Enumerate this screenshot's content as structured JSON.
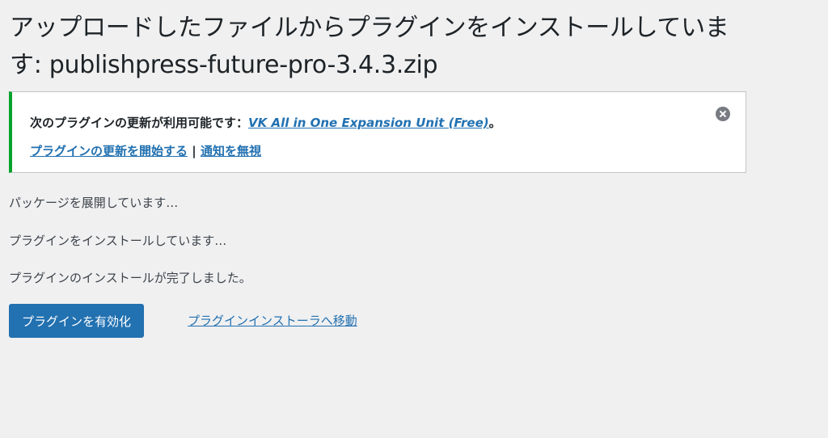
{
  "page": {
    "title": "アップロードしたファイルからプラグインをインストールしています: publishpress-future-pro-3.4.3.zip"
  },
  "notice": {
    "prefix": "次のプラグインの更新が利用可能です：",
    "plugin_name": "VK All in One Expansion Unit (Free)",
    "suffix": "。",
    "update_link": "プラグインの更新を開始する",
    "separator": " | ",
    "ignore_link": "通知を無視",
    "accent_color": "#00a32a",
    "dismiss_icon": "dismiss-icon"
  },
  "messages": [
    "パッケージを展開しています…",
    "プラグインをインストールしています…",
    "プラグインのインストールが完了しました。"
  ],
  "actions": {
    "activate_label": "プラグインを有効化",
    "installer_link_label": "プラグインインストーラへ移動"
  },
  "colors": {
    "primary": "#2271b1",
    "background": "#f0f0f1"
  }
}
